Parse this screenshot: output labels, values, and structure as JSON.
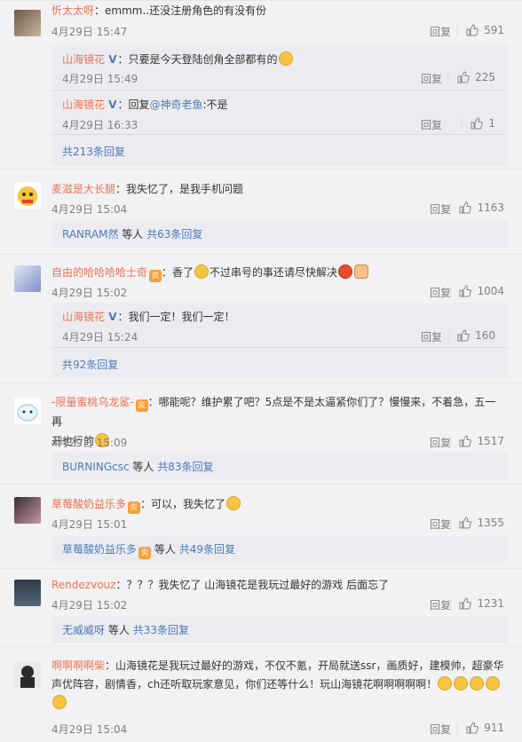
{
  "ui": {
    "reply_label": "回复",
    "etc_label": "等人"
  },
  "comments": [
    {
      "user": "忻太太呀",
      "text": "：emmm..还没注册角色的有没有份",
      "time": "4月29日 15:47",
      "likes": "591",
      "replies": [
        {
          "user": "山海镜花",
          "text": "：只要是今天登陆创角全部都有的",
          "time": "4月29日 15:49",
          "likes": "225"
        },
        {
          "user": "山海镜花",
          "text_prefix": "：回复",
          "mention": "@神奇老鱼",
          "text": ":不是",
          "time": "4月29日 16:33",
          "likes": "1"
        }
      ],
      "more": "共213条回复"
    },
    {
      "user": "麦滋是大长腿",
      "text": "：我失忆了，是我手机问题",
      "time": "4月29日 15:04",
      "likes": "1163",
      "more_user": "RANRAM然",
      "more": "共63条回复"
    },
    {
      "user": "自由的哈哈哈哈士奇",
      "text": "：香了",
      "text2": "不过串号的事还请尽快解决",
      "time": "4月29日 15:02",
      "likes": "1004",
      "replies": [
        {
          "user": "山海镜花",
          "text": "：我们一定！我们一定！",
          "time": "4月29日 15:24",
          "likes": "160"
        }
      ],
      "more": "共92条回复"
    },
    {
      "user": "-限量蜜桃乌龙鲨-",
      "text": "：哪能呢？维护累了吧？5点是不是太逼紧你们了？慢慢来，不着急，五一再",
      "text_line2": "开也行的",
      "time": "4月29日 15:09",
      "likes": "1517",
      "more_user": "BURNINGcsc",
      "more": "共83条回复"
    },
    {
      "user": "草莓酸奶益乐多",
      "text": "：可以，我失忆了",
      "time": "4月29日 15:01",
      "likes": "1355",
      "more_user": "草莓酸奶益乐多",
      "more": "共49条回复"
    },
    {
      "user": "Rendezvouz",
      "text": "：？？？我失忆了 山海镜花是我玩过最好的游戏 后面忘了",
      "time": "4月29日 15:02",
      "likes": "1231",
      "more_user": "无威威呀",
      "more": "共33条回复"
    },
    {
      "user": "啊啊啊啊柴",
      "text": "：山海镜花是我玩过最好的游戏，不仅不氪，开局就送ssr，画质好，建模帅，超豪华",
      "text_line2": "声优阵容，剧情香，ch还听取玩家意见，你们还等什么！玩山海镜花啊啊啊啊啊！",
      "time": "4月29日 15:04",
      "likes": "911"
    }
  ]
}
